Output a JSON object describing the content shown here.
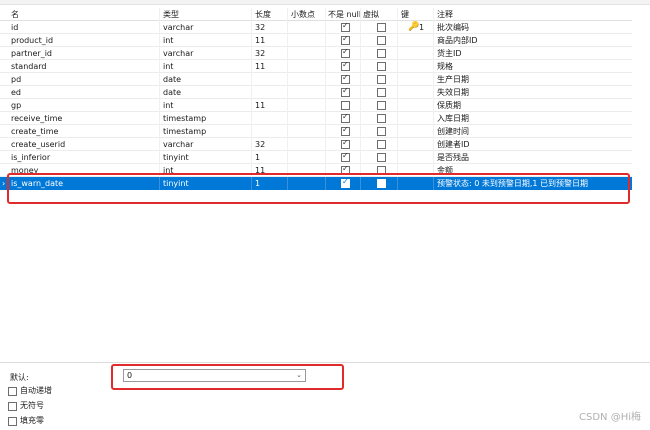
{
  "header": {
    "name": "名",
    "type": "类型",
    "length": "长度",
    "decimals": "小数点",
    "not_null": "不是 null",
    "virtual": "虚拟",
    "key": "键",
    "comment": "注释"
  },
  "fields": [
    {
      "name": "id",
      "type": "varchar",
      "length": "32",
      "not_null": true,
      "virtual": false,
      "key": "1",
      "comment": "批次编码"
    },
    {
      "name": "product_id",
      "type": "int",
      "length": "11",
      "not_null": true,
      "virtual": false,
      "key": "",
      "comment": "商品内部ID"
    },
    {
      "name": "partner_id",
      "type": "varchar",
      "length": "32",
      "not_null": true,
      "virtual": false,
      "key": "",
      "comment": "货主ID"
    },
    {
      "name": "standard",
      "type": "int",
      "length": "11",
      "not_null": true,
      "virtual": false,
      "key": "",
      "comment": "规格"
    },
    {
      "name": "pd",
      "type": "date",
      "length": "",
      "not_null": true,
      "virtual": false,
      "key": "",
      "comment": "生产日期"
    },
    {
      "name": "ed",
      "type": "date",
      "length": "",
      "not_null": true,
      "virtual": false,
      "key": "",
      "comment": "失效日期"
    },
    {
      "name": "gp",
      "type": "int",
      "length": "11",
      "not_null": false,
      "virtual": false,
      "key": "",
      "comment": "保质期"
    },
    {
      "name": "receive_time",
      "type": "timestamp",
      "length": "",
      "not_null": true,
      "virtual": false,
      "key": "",
      "comment": "入库日期"
    },
    {
      "name": "create_time",
      "type": "timestamp",
      "length": "",
      "not_null": true,
      "virtual": false,
      "key": "",
      "comment": "创建时间"
    },
    {
      "name": "create_userid",
      "type": "varchar",
      "length": "32",
      "not_null": true,
      "virtual": false,
      "key": "",
      "comment": "创建者ID"
    },
    {
      "name": "is_inferior",
      "type": "tinyint",
      "length": "1",
      "not_null": true,
      "virtual": false,
      "key": "",
      "comment": "是否残品"
    },
    {
      "name": "money",
      "type": "int",
      "length": "11",
      "not_null": true,
      "virtual": false,
      "key": "",
      "comment": "金额"
    },
    {
      "name": "is_warn_date",
      "type": "tinyint",
      "length": "1",
      "not_null": true,
      "virtual": false,
      "key": "",
      "comment": "预警状态: 0 未到预警日期,1 已到预警日期",
      "selected": true
    }
  ],
  "bottom": {
    "default_label": "默认:",
    "default_value": "0",
    "options": [
      "自动递增",
      "无符号",
      "填充零"
    ]
  },
  "watermark": "CSDN @Hi梅",
  "colors": {
    "selection": "#0078d7",
    "highlight_box": "#e12b2b",
    "key_icon": "#d9a21a"
  }
}
